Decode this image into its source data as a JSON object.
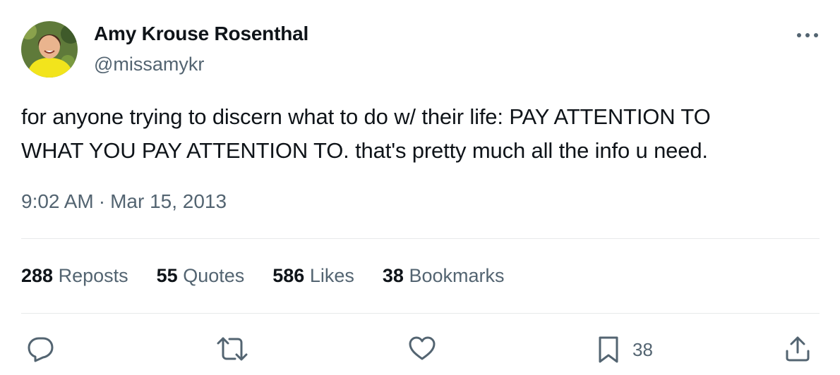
{
  "author": {
    "name": "Amy Krouse Rosenthal",
    "handle": "@missamykr"
  },
  "tweet": {
    "text_line1": "for anyone trying to discern what to do w/ their life: PAY ATTENTION TO",
    "text_line2": "WHAT YOU PAY ATTENTION TO. that's pretty much all the info u need.",
    "time": "9:02 AM",
    "separator": "·",
    "date": "Mar 15, 2013"
  },
  "stats": [
    {
      "count": "288",
      "label": "Reposts"
    },
    {
      "count": "55",
      "label": "Quotes"
    },
    {
      "count": "586",
      "label": "Likes"
    },
    {
      "count": "38",
      "label": "Bookmarks"
    }
  ],
  "actions": {
    "bookmark_count": "38",
    "icons": [
      "reply-icon",
      "repost-icon",
      "like-icon",
      "bookmark-icon",
      "share-icon"
    ]
  },
  "colors": {
    "text": "#0f1419",
    "secondary": "#536471",
    "divider": "#e7e9ea"
  }
}
